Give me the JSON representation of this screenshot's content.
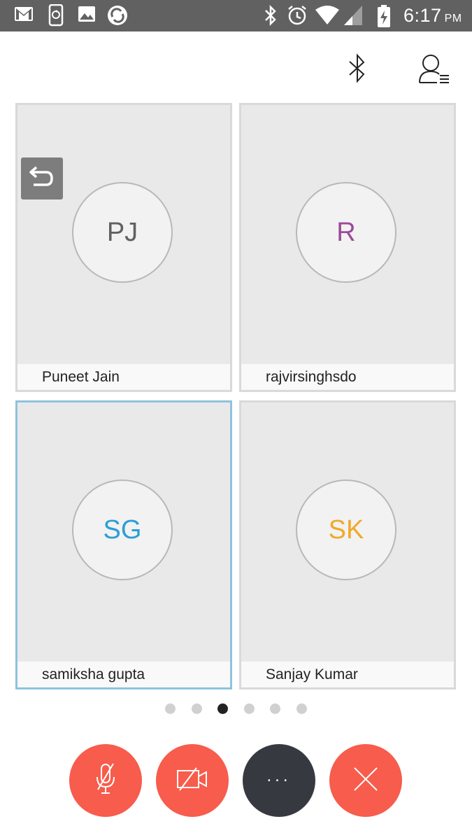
{
  "status_bar": {
    "time": "6:17",
    "ampm": "PM",
    "left_icons": [
      "gmail-icon",
      "phone-sync-icon",
      "gallery-icon",
      "sync-circle-icon"
    ],
    "right_icons": [
      "bluetooth-icon",
      "alarm-icon",
      "wifi-icon",
      "signal-icon",
      "battery-charging-icon"
    ]
  },
  "app_bar": {
    "icons": [
      "bluetooth-icon",
      "participants-icon"
    ]
  },
  "participants": [
    {
      "initials": "PJ",
      "name": "Puneet Jain",
      "initials_color": "#616161",
      "active": false
    },
    {
      "initials": "R",
      "name": "rajvirsinghsdo",
      "initials_color": "#9c4a9a",
      "active": false
    },
    {
      "initials": "SG",
      "name": "samiksha gupta",
      "initials_color": "#2a9fd6",
      "active": true
    },
    {
      "initials": "SK",
      "name": "Sanjay Kumar",
      "initials_color": "#f0a92a",
      "active": false
    }
  ],
  "pager": {
    "count": 6,
    "current": 3
  },
  "controls": [
    {
      "name": "mute-mic-button",
      "icon": "mic-off-icon",
      "color": "#f75c4c"
    },
    {
      "name": "stop-video-button",
      "icon": "video-off-icon",
      "color": "#f75c4c"
    },
    {
      "name": "more-options-button",
      "icon": "more-icon",
      "label": "...",
      "color": "#363a40"
    },
    {
      "name": "end-call-button",
      "icon": "close-icon",
      "color": "#f75c4c"
    }
  ],
  "colors": {
    "status_bar": "#616161",
    "tile_bg": "#e9e9e9",
    "tile_border": "#d9d9d9",
    "active_border": "#8fc3dc",
    "control_red": "#f75c4c"
  }
}
